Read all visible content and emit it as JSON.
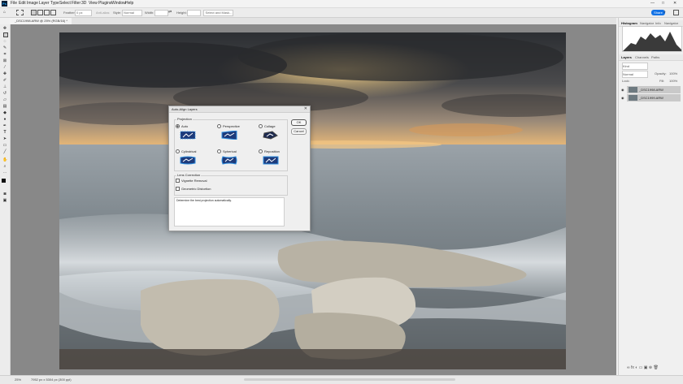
{
  "app": {
    "logo": "Ps",
    "accent": "#1473e6"
  },
  "menubar": {
    "items": [
      "File",
      "Edit",
      "Image",
      "Layer",
      "Type",
      "Select",
      "Filter",
      "3D",
      "View",
      "Plugins",
      "Window",
      "Help"
    ],
    "window_controls": [
      "—",
      "□",
      "✕"
    ]
  },
  "options": {
    "feather_label": "Feather:",
    "feather_value": "0 px",
    "antialias_label": "Anti-alias",
    "style_label": "Style:",
    "style_value": "Normal",
    "width_label": "Width:",
    "height_label": "Height:",
    "select_mask": "Select and Mask...",
    "share": "Share"
  },
  "document": {
    "tab_title": "_DSC1998.ARW @ 25% (RGB/16) *"
  },
  "panels": {
    "top_tabs": [
      "Histogram",
      "Navigator",
      "Info",
      "Navigator"
    ],
    "layer_tabs": [
      "Layers",
      "Channels",
      "Paths"
    ],
    "kind_label": "Kind",
    "blend_mode": "Normal",
    "opacity_label": "Opacity:",
    "opacity_value": "100%",
    "lock_label": "Lock:",
    "fill_label": "Fill:",
    "fill_value": "100%",
    "layers": [
      "_DSC1998.ARW",
      "_DSC1999.ARW"
    ]
  },
  "status": {
    "zoom": "25%",
    "doc_size": "7952 px x 5304 px (300 ppi)"
  },
  "dialog": {
    "title": "Auto-Align Layers",
    "projection_label": "Projection",
    "options": [
      {
        "label": "Auto",
        "selected": true
      },
      {
        "label": "Perspective",
        "selected": false
      },
      {
        "label": "Collage",
        "selected": false
      },
      {
        "label": "Cylindrical",
        "selected": false
      },
      {
        "label": "Spherical",
        "selected": false
      },
      {
        "label": "Reposition",
        "selected": false
      }
    ],
    "ok": "OK",
    "cancel": "Cancel",
    "lens_label": "Lens Correction",
    "vignette": "Vignette Removal",
    "geometric": "Geometric Distortion",
    "description": "Determine the best projection automatically."
  }
}
